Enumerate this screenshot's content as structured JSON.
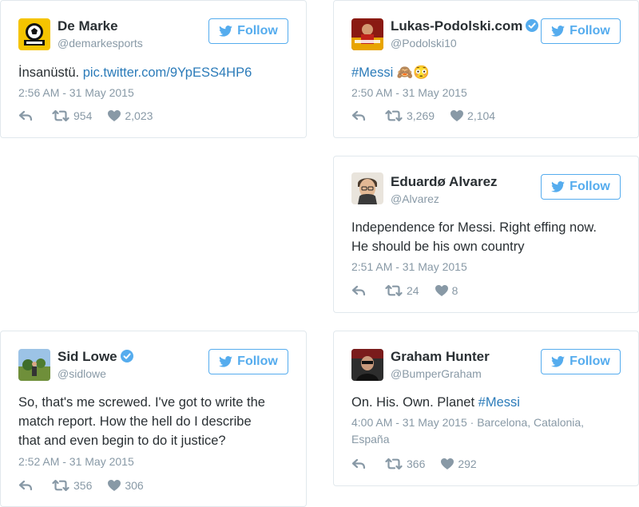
{
  "brand_color": "#55acee",
  "link_color": "#2b7bb9",
  "follow_label": "Follow",
  "tweets": [
    {
      "name": "De Marke",
      "handle": "@demarkesports",
      "verified": false,
      "text": "İnsanüstü.",
      "link": "pic.twitter.com/9YpESS4HP6",
      "time": "2:56 AM - 31 May 2015",
      "retweets": "954",
      "likes": "2,023"
    },
    {
      "name": "Lukas-Podolski.com",
      "handle": "@Podolski10",
      "verified": true,
      "hashtag": "#Messi",
      "emoji": "🙈😳",
      "time": "2:50 AM - 31 May 2015",
      "retweets": "3,269",
      "likes": "2,104"
    },
    {
      "name": "Eduardø Alvarez",
      "handle": "@Alvarez",
      "verified": false,
      "text_line1": "Independence for Messi. Right effing now.",
      "text_line2": "He should be his own country",
      "time": "2:51 AM - 31 May 2015",
      "retweets": "24",
      "likes": "8"
    },
    {
      "name": "Sid Lowe",
      "handle": "@sidlowe",
      "verified": true,
      "text_line1": "So, that's me screwed. I've got to write the",
      "text_line2": "match report. How the hell do I describe",
      "text_line3": "that and even begin to do it justice?",
      "time": "2:52 AM - 31 May 2015",
      "retweets": "356",
      "likes": "306"
    },
    {
      "name": "Graham Hunter",
      "handle": "@BumperGraham",
      "verified": false,
      "text": "On. His. Own. Planet",
      "hashtag": "#Messi",
      "time_line1": "4:00 AM - 31 May 2015 · Barcelona, Catalonia,",
      "time_line2": "España",
      "retweets": "366",
      "likes": "292"
    }
  ]
}
